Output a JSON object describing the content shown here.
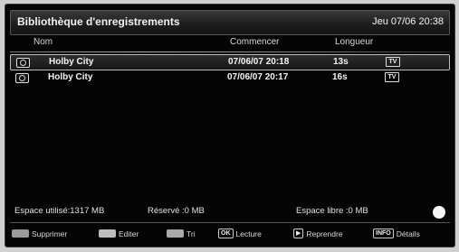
{
  "header": {
    "title": "Bibliothèque d'enregistrements",
    "datetime": "Jeu 07/06 20:38"
  },
  "columns": {
    "name": "Nom",
    "start": "Commencer",
    "length": "Longueur"
  },
  "recordings": [
    {
      "name": "Holby City",
      "start": "07/06/07  20:18",
      "length": "13s",
      "type_icon": "TV",
      "selected": true
    },
    {
      "name": "Holby City",
      "start": "07/06/07  20:17",
      "length": "16s",
      "type_icon": "TV",
      "selected": false
    }
  ],
  "storage": {
    "used": "Espace utilisé:1317 MB",
    "reserved": "Réservé :0 MB",
    "free": "Espace libre :0 MB"
  },
  "footer": {
    "delete": "Supprimer",
    "edit": "Editer",
    "sort": "Tri",
    "play_key": "OK",
    "play": "Lecture",
    "resume": "Reprendre",
    "info_key": "INFO",
    "details": "Détails"
  }
}
